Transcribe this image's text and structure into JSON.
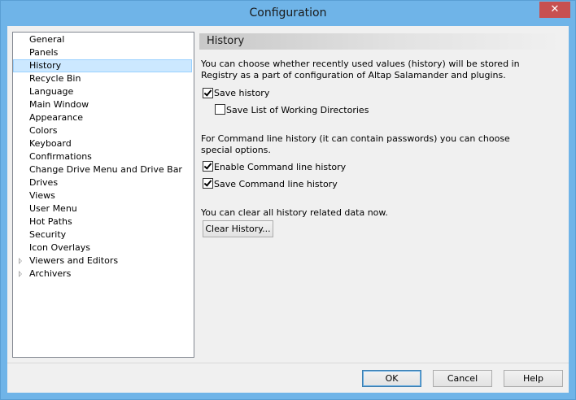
{
  "window": {
    "title": "Configuration",
    "close_glyph": "✕"
  },
  "tree": {
    "items": [
      {
        "label": "General",
        "expandable": false
      },
      {
        "label": "Panels",
        "expandable": false
      },
      {
        "label": "History",
        "expandable": false,
        "selected": true
      },
      {
        "label": "Recycle Bin",
        "expandable": false
      },
      {
        "label": "Language",
        "expandable": false
      },
      {
        "label": "Main Window",
        "expandable": false
      },
      {
        "label": "Appearance",
        "expandable": false
      },
      {
        "label": "Colors",
        "expandable": false
      },
      {
        "label": "Keyboard",
        "expandable": false
      },
      {
        "label": "Confirmations",
        "expandable": false
      },
      {
        "label": "Change Drive Menu and Drive Bar",
        "expandable": false
      },
      {
        "label": "Drives",
        "expandable": false
      },
      {
        "label": "Views",
        "expandable": false
      },
      {
        "label": "User Menu",
        "expandable": false
      },
      {
        "label": "Hot Paths",
        "expandable": false
      },
      {
        "label": "Security",
        "expandable": false
      },
      {
        "label": "Icon Overlays",
        "expandable": false
      },
      {
        "label": "Viewers and Editors",
        "expandable": true
      },
      {
        "label": "Archivers",
        "expandable": true
      }
    ]
  },
  "panel": {
    "header": "History",
    "intro_line1": "You can choose whether recently used values (history) will be stored in",
    "intro_line2": "Registry as a part of configuration of Altap Salamander and plugins.",
    "save_history": {
      "label": "Save history",
      "checked": true
    },
    "save_dirs": {
      "label": "Save List of Working Directories",
      "checked": false
    },
    "cmd_line1": "For Command line history (it can contain passwords) you can choose",
    "cmd_line2": "special options.",
    "enable_cmd": {
      "label": "Enable Command line history",
      "checked": true
    },
    "save_cmd": {
      "label": "Save Command line history",
      "checked": true
    },
    "clear_text": "You can clear all history related data now.",
    "clear_button": "Clear History..."
  },
  "buttons": {
    "ok": "OK",
    "cancel": "Cancel",
    "help": "Help"
  },
  "colors": {
    "selection_bg": "#cce8ff",
    "title_bar": "#6fb4e8",
    "close_button": "#c75050"
  }
}
